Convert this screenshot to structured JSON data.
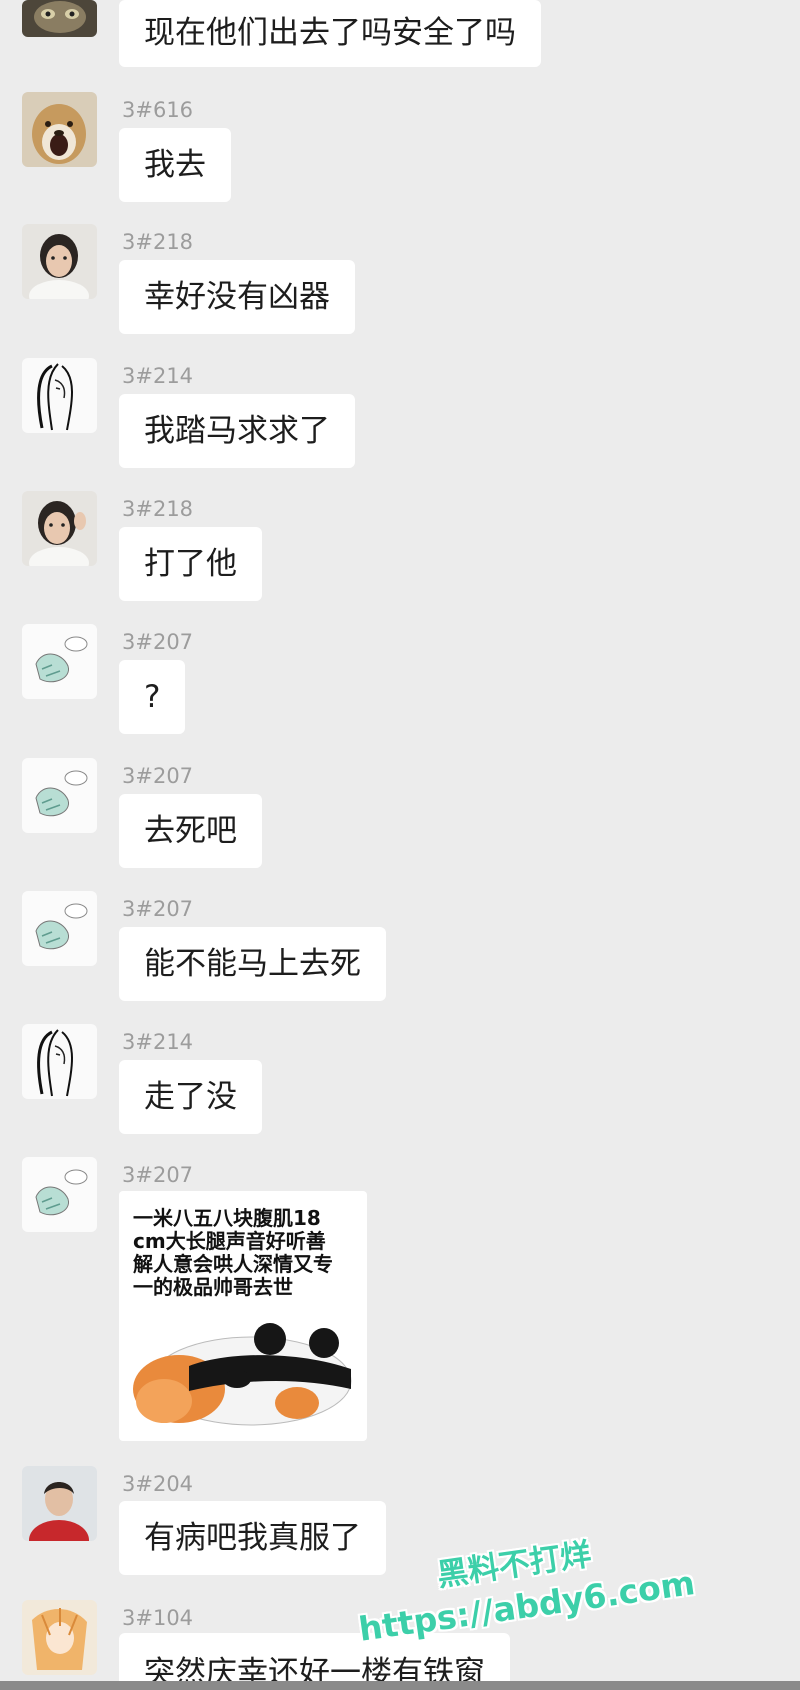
{
  "colors": {
    "background": "#ececec",
    "bubble": "#ffffff",
    "sender": "#9c9c9c",
    "watermark": "#3ccfa9"
  },
  "messages": [
    {
      "text": "现在他们出去了吗安全了吗"
    },
    {
      "sender": "3#616",
      "text": "我去"
    },
    {
      "sender": "3#218",
      "text": "幸好没有凶器"
    },
    {
      "sender": "3#214",
      "text": "我踏马求求了"
    },
    {
      "sender": "3#218",
      "text": "打了他"
    },
    {
      "sender": "3#207",
      "text": "?"
    },
    {
      "sender": "3#207",
      "text": "去死吧"
    },
    {
      "sender": "3#207",
      "text": "能不能马上去死"
    },
    {
      "sender": "3#214",
      "text": "走了没"
    },
    {
      "sender": "3#207"
    },
    {
      "sender": "3#204",
      "text": "有病吧我真服了"
    },
    {
      "sender": "3#104",
      "text": "突然庆幸还好一楼有铁窗"
    }
  ],
  "sticker": {
    "lines": [
      "一米八五八块腹肌18",
      "cm大长腿声音好听善",
      "解人意会哄人深情又专",
      "一的极品帅哥去世"
    ]
  },
  "watermark": {
    "line1": "黑料不打烊",
    "line2": "https://abdy6.com"
  }
}
